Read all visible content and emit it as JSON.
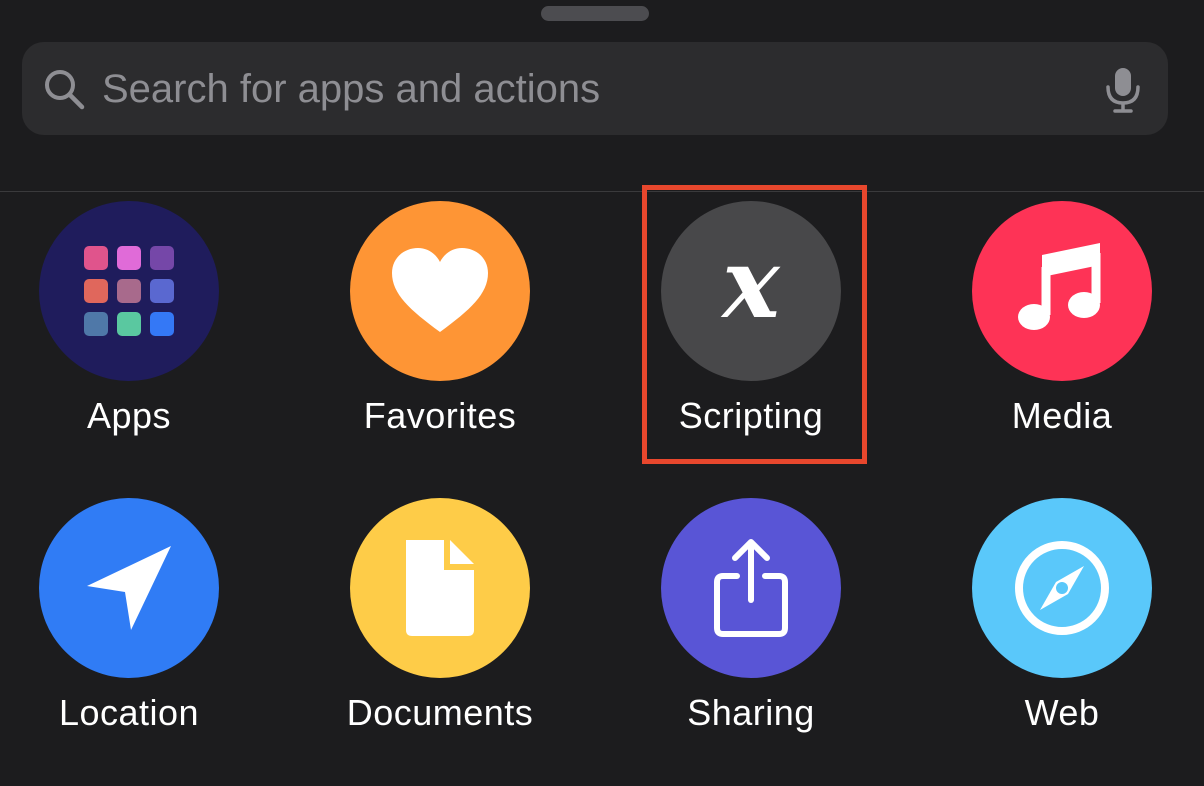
{
  "search": {
    "placeholder": "Search for apps and actions"
  },
  "categories": [
    {
      "label": "Apps",
      "icon": "apps-grid-icon",
      "color": "#1f1c5c"
    },
    {
      "label": "Favorites",
      "icon": "heart-icon",
      "color": "#fe9535"
    },
    {
      "label": "Scripting",
      "icon": "variable-x-icon",
      "color": "#48484a"
    },
    {
      "label": "Media",
      "icon": "music-note-icon",
      "color": "#fe3356"
    },
    {
      "label": "Location",
      "icon": "location-arrow-icon",
      "color": "#307cf5"
    },
    {
      "label": "Documents",
      "icon": "document-icon",
      "color": "#fecc48"
    },
    {
      "label": "Sharing",
      "icon": "share-icon",
      "color": "#5955d6"
    },
    {
      "label": "Web",
      "icon": "compass-icon",
      "color": "#5ac8fa"
    }
  ],
  "highlight": {
    "target": "Scripting",
    "color": "#e8472d"
  }
}
